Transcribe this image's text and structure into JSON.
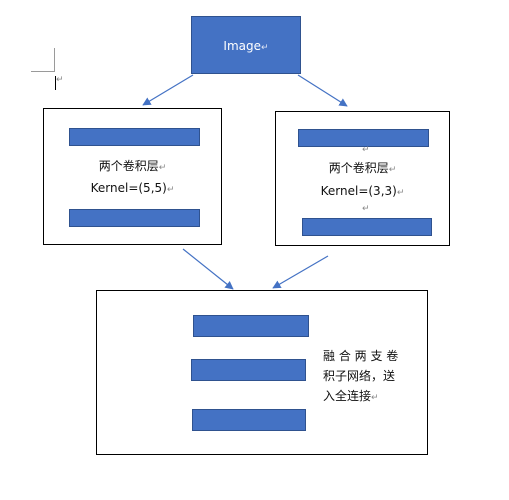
{
  "top_node": {
    "label": "Image",
    "mark": "↵"
  },
  "left_branch": {
    "line1": "两个卷积层",
    "line2": "Kernel=(5,5)",
    "mark": "↵"
  },
  "right_branch": {
    "line1": "两个卷积层",
    "line2": "Kernel=(3,3)",
    "mark": "↵"
  },
  "bottom_node": {
    "line1": "融 合 两 支 卷",
    "line2": "积子网络，送",
    "line3": "入全连接",
    "mark": "↵"
  },
  "document_mark": "↵",
  "colors": {
    "accent": "#4472c4",
    "arrow": "#4472c4",
    "border": "#000000"
  }
}
